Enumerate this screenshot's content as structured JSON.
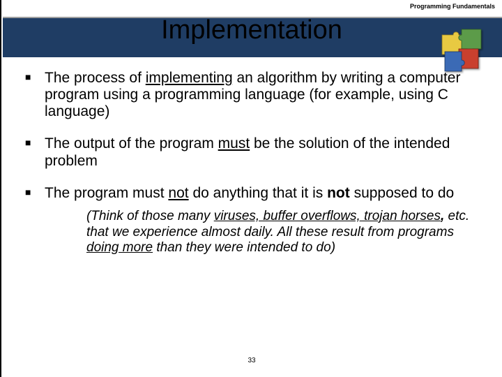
{
  "header": "Programming Fundamentals",
  "title": "Implementation",
  "bullets": {
    "b1": {
      "pre": "The process of ",
      "u": "implementing",
      "post": " an algorithm by writing a computer program using a programming language (for example, using C language)"
    },
    "b2": {
      "pre": "The output of the program ",
      "u": "must",
      "post": " be the solution of the intended problem"
    },
    "b3": {
      "pre": "The program must ",
      "u": "not",
      "mid": " do anything that it is ",
      "bold": "not",
      "post": " supposed to do"
    }
  },
  "sub": {
    "s1": "(Think of those many ",
    "u1": "viruses, buffer overflows, trojan horses",
    "comma": ",",
    "s2": " etc. that we experience almost daily. All these result from programs ",
    "u2": "doing more",
    "s3": " than they were intended to do)"
  },
  "page": "33"
}
